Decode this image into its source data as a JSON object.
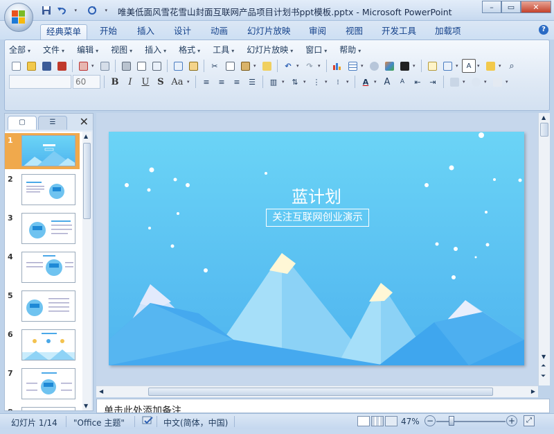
{
  "window": {
    "title": "唯美低面风雪花雪山封面互联网产品项目计划书ppt模板.pptx - Microsoft PowerPoint",
    "minimize_glyph": "–",
    "maximize_glyph": "▭",
    "close_glyph": "✕"
  },
  "ribbon_tabs": [
    {
      "label": "经典菜单"
    },
    {
      "label": "开始"
    },
    {
      "label": "插入"
    },
    {
      "label": "设计"
    },
    {
      "label": "动画"
    },
    {
      "label": "幻灯片放映"
    },
    {
      "label": "审阅"
    },
    {
      "label": "视图"
    },
    {
      "label": "开发工具"
    },
    {
      "label": "加载项"
    }
  ],
  "menus": [
    {
      "label": "全部"
    },
    {
      "label": "文件"
    },
    {
      "label": "编辑"
    },
    {
      "label": "视图"
    },
    {
      "label": "插入"
    },
    {
      "label": "格式"
    },
    {
      "label": "工具"
    },
    {
      "label": "幻灯片放映"
    },
    {
      "label": "窗口"
    },
    {
      "label": "帮助"
    }
  ],
  "font": {
    "name": "",
    "size": "60"
  },
  "format_buttons": {
    "bold": "B",
    "italic": "I",
    "underline": "U",
    "shadow": "S",
    "case": "Aa"
  },
  "panel": {
    "close_glyph": "✕"
  },
  "slides": [
    {
      "number": "1"
    },
    {
      "number": "2"
    },
    {
      "number": "3"
    },
    {
      "number": "4"
    },
    {
      "number": "5"
    },
    {
      "number": "6"
    },
    {
      "number": "7"
    },
    {
      "number": "8"
    }
  ],
  "slide": {
    "title": "蓝计划",
    "subtitle": "关注互联网创业演示"
  },
  "notes": {
    "placeholder": "单击此处添加备注"
  },
  "status": {
    "slide_counter": "幻灯片 1/14",
    "theme": "\"Office 主题\"",
    "language": "中文(简体，中国)",
    "zoom": "47%"
  },
  "colors": {
    "sky_top": "#6bd4f6",
    "sky_bottom": "#4fb5ef",
    "selected_thumb": "#f0a94c",
    "ribbon_text": "#15428b"
  }
}
